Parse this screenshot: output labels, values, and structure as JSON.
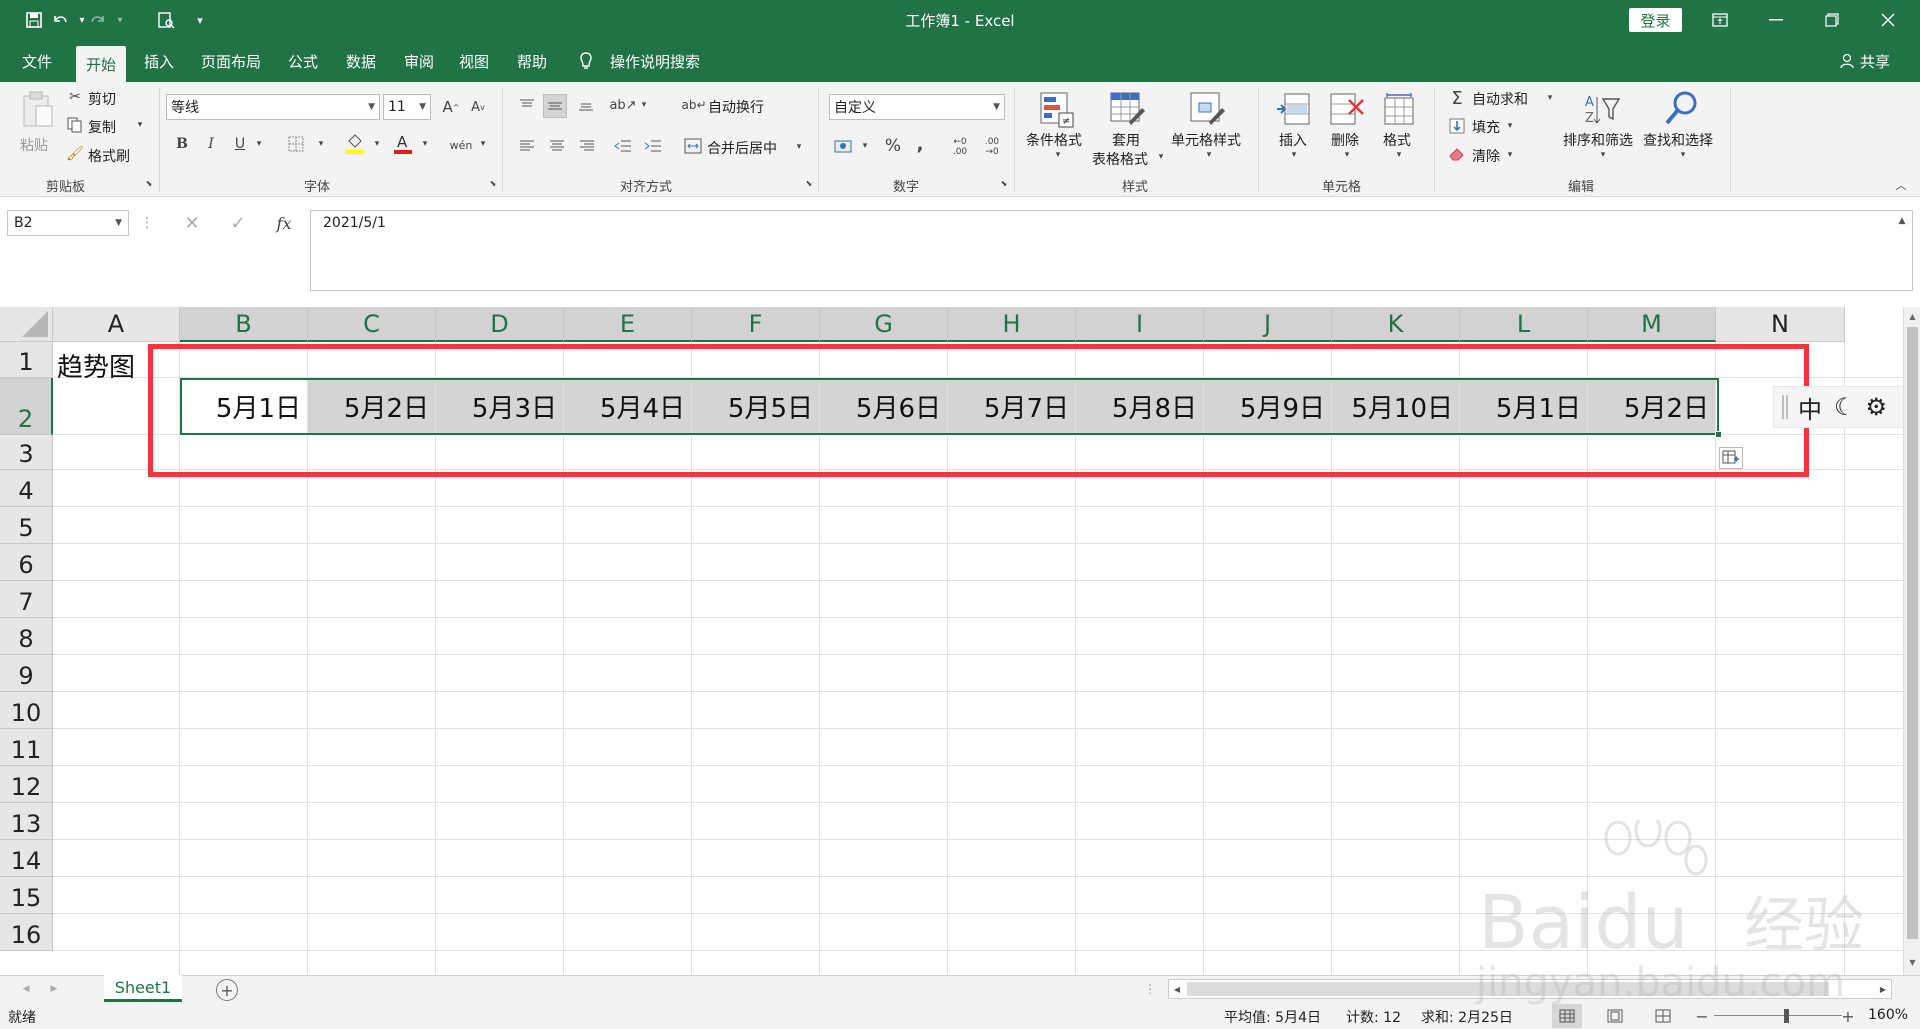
{
  "quick_access": {
    "save_icon": "save-icon",
    "undo_icon": "undo-icon",
    "redo_icon": "redo-icon",
    "preview_icon": "print-preview-icon",
    "customize_icon": "customize-icon"
  },
  "window": {
    "title": "工作簿1  -  Excel",
    "login_label": "登录"
  },
  "menu": {
    "items": [
      "文件",
      "开始",
      "插入",
      "页面布局",
      "公式",
      "数据",
      "审阅",
      "视图",
      "帮助"
    ],
    "tell_me": "操作说明搜索",
    "share": "共享"
  },
  "ribbon": {
    "clipboard": {
      "paste": "粘贴",
      "cut": "剪切",
      "copy": "复制",
      "format_painter": "格式刷",
      "group": "剪贴板"
    },
    "font": {
      "font_name": "等线",
      "font_size": "11",
      "group": "字体"
    },
    "alignment": {
      "wrap": "自动换行",
      "merge": "合并后居中",
      "group": "对齐方式"
    },
    "number": {
      "format": "自定义",
      "group": "数字"
    },
    "styles": {
      "conditional": "条件格式",
      "table_line1": "套用",
      "table_line2": "表格格式",
      "cell_style": "单元格样式",
      "group": "样式"
    },
    "cells": {
      "insert": "插入",
      "delete": "删除",
      "format": "格式",
      "group": "单元格"
    },
    "editing": {
      "autosum": "自动求和",
      "fill": "填充",
      "clear": "清除",
      "sort": "排序和筛选",
      "find": "查找和选择",
      "group": "编辑"
    }
  },
  "formula_bar": {
    "name_box": "B2",
    "formula": "2021/5/1",
    "fx": "fx"
  },
  "grid": {
    "columns": [
      "A",
      "B",
      "C",
      "D",
      "E",
      "F",
      "G",
      "H",
      "I",
      "J",
      "K",
      "L",
      "M",
      "N"
    ],
    "rows": [
      "1",
      "2",
      "3",
      "4",
      "5",
      "6",
      "7",
      "8",
      "9",
      "10",
      "11",
      "12",
      "13",
      "14",
      "15",
      "16"
    ],
    "a1": "趋势图",
    "row2": [
      "5月1日",
      "5月2日",
      "5月3日",
      "5月4日",
      "5月5日",
      "5月6日",
      "5月7日",
      "5月8日",
      "5月9日",
      "5月10日",
      "5月1日",
      "5月2日"
    ]
  },
  "ime": {
    "lang": "中"
  },
  "sheets": {
    "tab": "Sheet1"
  },
  "status": {
    "ready": "就绪",
    "average": "平均值: 5月4日",
    "count": "计数: 12",
    "sum": "求和: 2月25日",
    "zoom": "160%"
  },
  "watermark": {
    "brand": "Baidu",
    "site": "jingyan.baidu.com",
    "brand_cn": "经验"
  }
}
